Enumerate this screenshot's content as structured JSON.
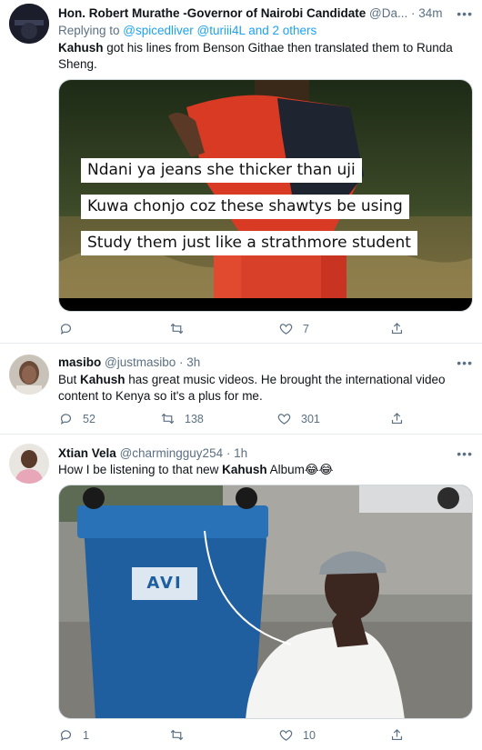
{
  "tweets": [
    {
      "name": "Hon. Robert Murathe -Governor of Nairobi Candidate",
      "handle": "@Da...",
      "time": "34m",
      "more": "•••",
      "replying_prefix": "Replying to ",
      "replying_mentions": "@spicedliver @turiii4L and 2 others",
      "text_bold": "Kahush",
      "text_rest": " got his lines from Benson Githae then translated them to Runda Sheng.",
      "media_captions": [
        "Ndani ya jeans she thicker than uji",
        "Kuwa chonjo coz these shawtys be using",
        "Study them just like a strathmore student"
      ],
      "reply_count": "",
      "retweet_count": "",
      "like_count": "7"
    },
    {
      "name": "masibo",
      "handle": "@justmasibo",
      "time": "3h",
      "more": "•••",
      "text_pre": "But ",
      "text_bold": "Kahush",
      "text_rest": " has great music videos. He brought the international video content to Kenya so it's a plus for me.",
      "reply_count": "52",
      "retweet_count": "138",
      "like_count": "301"
    },
    {
      "name": "Xtian Vela",
      "handle": "@charmingguy254",
      "time": "1h",
      "more": "•••",
      "text_pre": "How I be listening to that new ",
      "text_bold": "Kahush",
      "text_rest": " Album😂😂",
      "media_logo": "AVI",
      "reply_count": "1",
      "retweet_count": "",
      "like_count": "10"
    }
  ],
  "colors": {
    "text_secondary": "#5b7083",
    "link": "#1da1f2",
    "divider": "#e6ecf0"
  },
  "icons": [
    "reply-icon",
    "retweet-icon",
    "like-icon",
    "share-icon",
    "more-icon"
  ]
}
